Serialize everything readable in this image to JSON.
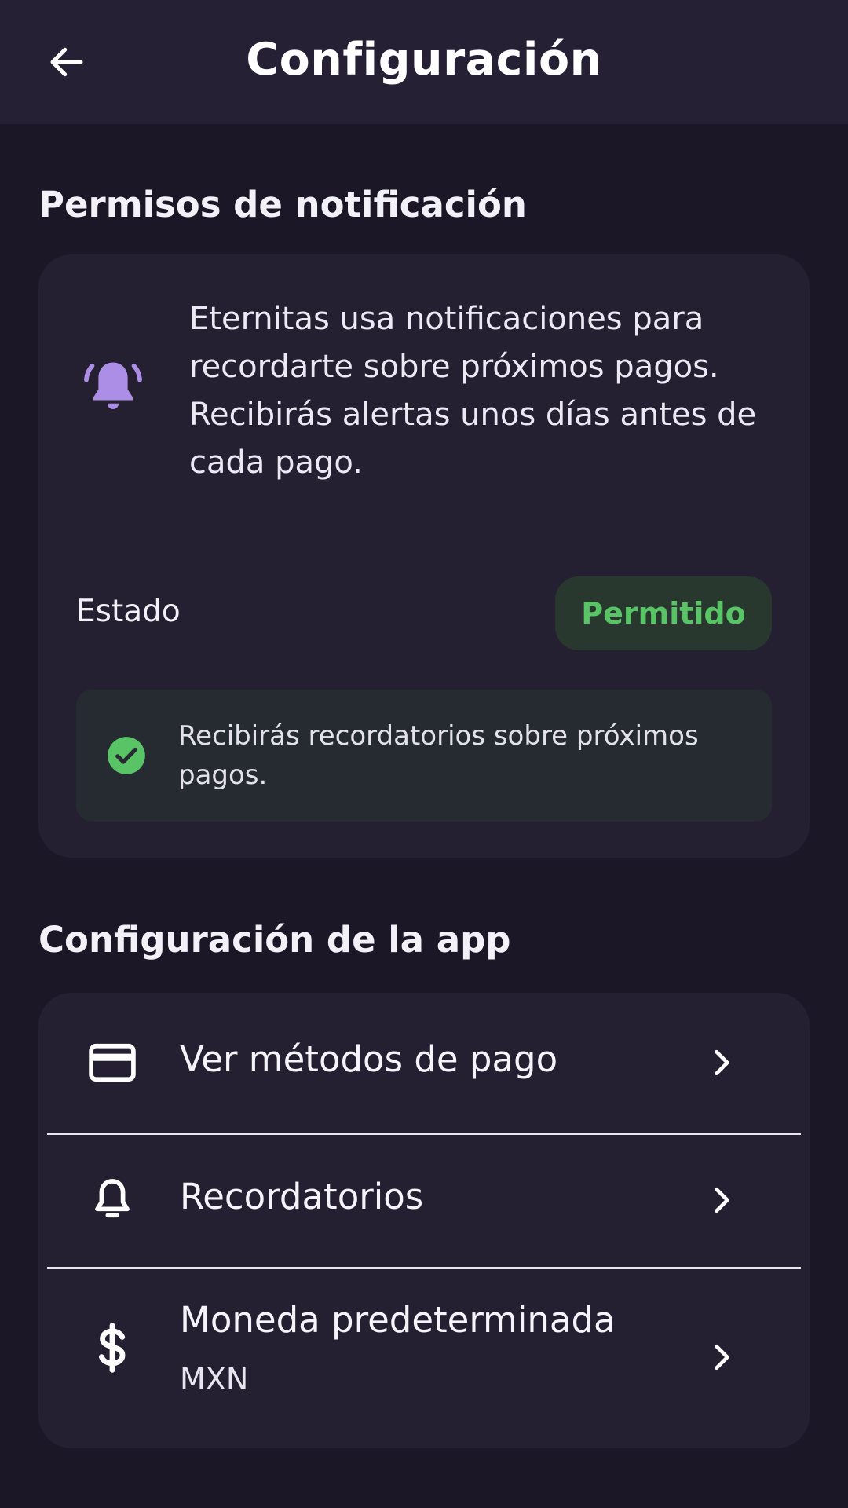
{
  "header": {
    "title": "Configuración",
    "back_icon": "arrow-left-icon"
  },
  "notifications": {
    "section_title": "Permisos de notificación",
    "icon": "bell-ringing-icon",
    "description": "Eternitas usa notificaciones para recordarte sobre próximos pagos. Recibirás alertas unos días antes de cada pago.",
    "status_label": "Estado",
    "status_value": "Permitido",
    "info_icon": "check-circle-icon",
    "info_text": "Recibirás recordatorios sobre próximos pagos."
  },
  "app_settings": {
    "section_title": "Configuración de la app",
    "items": [
      {
        "icon": "credit-card-icon",
        "label": "Ver métodos de pago"
      },
      {
        "icon": "bell-icon",
        "label": "Recordatorios"
      },
      {
        "icon": "dollar-icon",
        "label": "Moneda predeterminada",
        "sublabel": "MXN"
      }
    ]
  },
  "colors": {
    "background": "#1b1727",
    "app_bar": "#252033",
    "card": "#242032",
    "accent_purple": "#ad8ee6",
    "status_green": "#58c466",
    "status_bg": "#29382f"
  }
}
